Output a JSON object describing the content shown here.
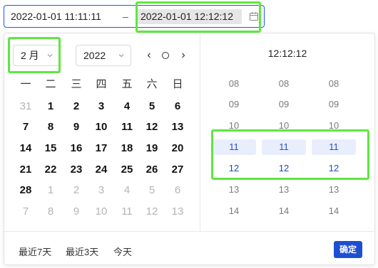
{
  "range": {
    "start": "2022-01-01 11:11:11",
    "separator": "–",
    "end": "2022-01-01 12:12:12"
  },
  "header": {
    "month_value": "2 月",
    "year_value": "2022",
    "prev_symbol": "‹",
    "next_symbol": "›"
  },
  "weekdays": [
    "一",
    "二",
    "三",
    "四",
    "五",
    "六",
    "日"
  ],
  "calendar": [
    [
      {
        "d": "31",
        "m": true
      },
      {
        "d": "1"
      },
      {
        "d": "2"
      },
      {
        "d": "3"
      },
      {
        "d": "4"
      },
      {
        "d": "5"
      },
      {
        "d": "6"
      }
    ],
    [
      {
        "d": "7"
      },
      {
        "d": "8"
      },
      {
        "d": "9"
      },
      {
        "d": "10"
      },
      {
        "d": "11"
      },
      {
        "d": "12"
      },
      {
        "d": "13"
      }
    ],
    [
      {
        "d": "14"
      },
      {
        "d": "15"
      },
      {
        "d": "16"
      },
      {
        "d": "17"
      },
      {
        "d": "18"
      },
      {
        "d": "19"
      },
      {
        "d": "20"
      }
    ],
    [
      {
        "d": "21"
      },
      {
        "d": "22"
      },
      {
        "d": "23"
      },
      {
        "d": "24"
      },
      {
        "d": "25"
      },
      {
        "d": "26"
      },
      {
        "d": "27"
      }
    ],
    [
      {
        "d": "28"
      },
      {
        "d": "1",
        "m": true
      },
      {
        "d": "2",
        "m": true
      },
      {
        "d": "3",
        "m": true
      },
      {
        "d": "4",
        "m": true
      },
      {
        "d": "5",
        "m": true
      },
      {
        "d": "6",
        "m": true
      }
    ],
    [
      {
        "d": "7",
        "m": true
      },
      {
        "d": "8",
        "m": true
      },
      {
        "d": "9",
        "m": true
      },
      {
        "d": "10",
        "m": true
      },
      {
        "d": "11",
        "m": true
      },
      {
        "d": "12",
        "m": true
      },
      {
        "d": "13",
        "m": true
      }
    ]
  ],
  "time": {
    "title": "12:12:12",
    "columns": [
      "hour",
      "minute",
      "second"
    ],
    "rows": [
      {
        "v": "08",
        "state": ""
      },
      {
        "v": "09",
        "state": ""
      },
      {
        "v": "10",
        "state": ""
      },
      {
        "v": "11",
        "state": "selected"
      },
      {
        "v": "12",
        "state": "active"
      },
      {
        "v": "13",
        "state": ""
      },
      {
        "v": "14",
        "state": ""
      }
    ]
  },
  "footer": {
    "shortcuts": [
      "最近7天",
      "最近3天",
      "今天"
    ],
    "confirm": "确定"
  },
  "colors": {
    "accent": "#1d4fd1",
    "highlight_box": "#5fe640",
    "selected_bg": "#e8eefc"
  }
}
